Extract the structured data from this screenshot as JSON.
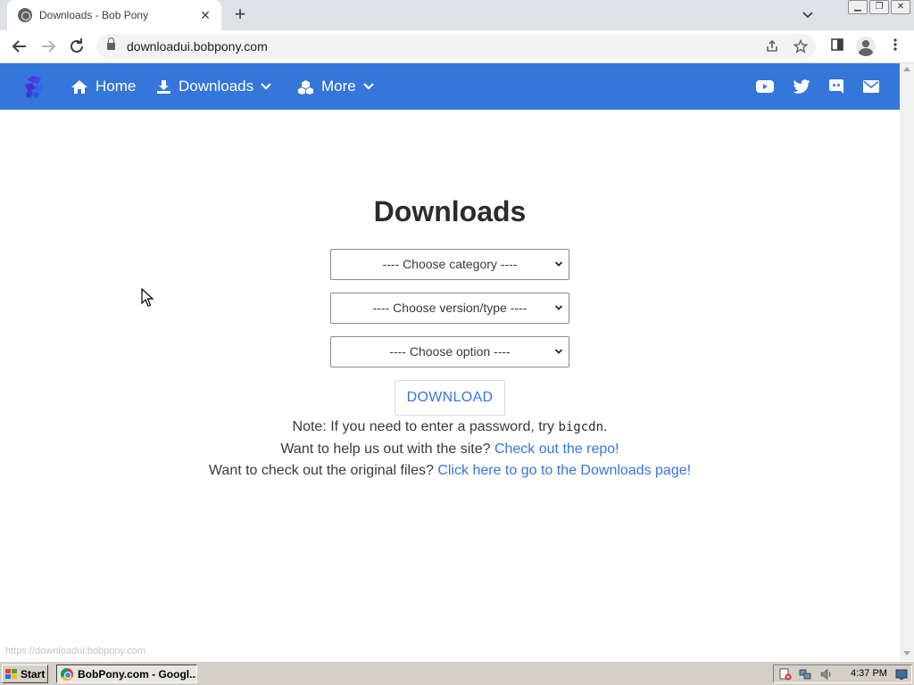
{
  "browser": {
    "tab_title": "Downloads - Bob Pony",
    "tab_close": "✕",
    "new_tab": "+",
    "url": "downloadui.bobpony.com",
    "status_url": "https://downloadui.bobpony.com"
  },
  "navbar": {
    "home_label": "Home",
    "downloads_label": "Downloads",
    "more_label": "More",
    "social_icons": [
      "youtube-icon",
      "twitter-icon",
      "discord-icon",
      "mail-icon"
    ],
    "color": "#3576db"
  },
  "main": {
    "title": "Downloads",
    "category_select": "---- Choose category ----",
    "version_select": "---- Choose version/type ----",
    "option_select": "---- Choose option ----",
    "download_button": "DOWNLOAD",
    "note_prefix": "Note: If you need to enter a password, try ",
    "note_code": "bigcdn",
    "note_suffix": ".",
    "help_prefix": "Want to help us out with the site? ",
    "help_link": "Check out the repo!",
    "files_prefix": "Want to check out the original files? ",
    "files_link": "Click here to go to the Downloads page!"
  },
  "taskbar": {
    "start_label": "Start",
    "task_label": "BobPony.com - Googl...",
    "clock": "4:37 PM"
  }
}
